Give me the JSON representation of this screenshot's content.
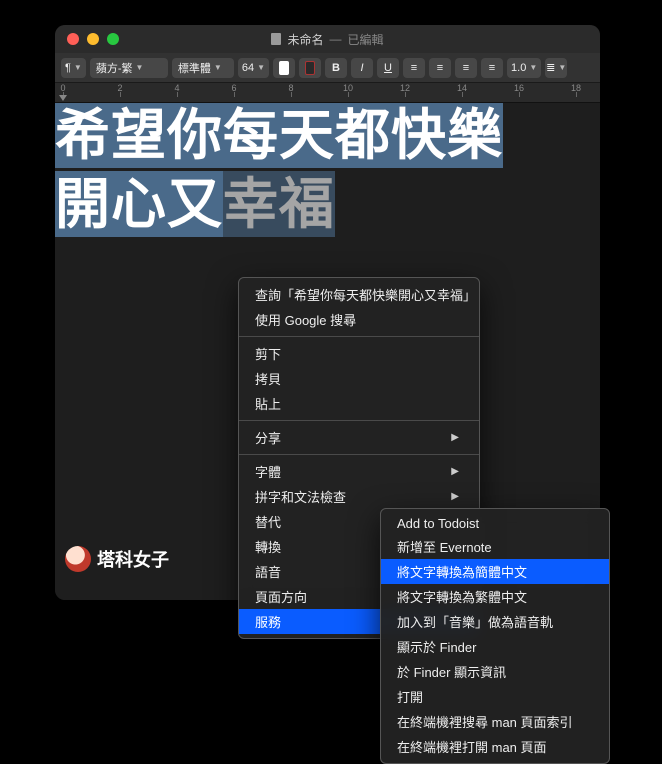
{
  "title": {
    "name": "未命名",
    "edited": "已編輯",
    "sep": "—"
  },
  "toolbar": {
    "paragraph": "¶",
    "font_family": "蘋方-繁",
    "font_style": "標準體",
    "font_size": "64",
    "bold": "B",
    "italic": "I",
    "underline": "U",
    "spacing": "1.0"
  },
  "ruler_ticks": [
    "0",
    "2",
    "4",
    "6",
    "8",
    "10",
    "12",
    "14",
    "16",
    "18"
  ],
  "document": {
    "line1": "希望你每天都快樂",
    "line2a": "開心又",
    "line2b": "幸福"
  },
  "logo": "塔科女子",
  "menu1": {
    "lookup": "查詢「希望你每天都快樂開心又幸福」",
    "google": "使用 Google 搜尋",
    "cut": "剪下",
    "copy": "拷貝",
    "paste": "貼上",
    "share": "分享",
    "font": "字體",
    "spellgrammar": "拼字和文法檢查",
    "substitute": "替代",
    "transform": "轉換",
    "speech": "語音",
    "pagedir": "頁面方向",
    "services": "服務"
  },
  "menu2": {
    "todoist": "Add to Todoist",
    "evernote": "新增至 Evernote",
    "to_simplified": "將文字轉換為簡體中文",
    "to_traditional": "將文字轉換為繁體中文",
    "add_music": "加入到「音樂」做為語音軌",
    "show_finder": "顯示於 Finder",
    "finder_info": "於 Finder 顯示資訊",
    "open": "打開",
    "man_search": "在終端機裡搜尋 man 頁面索引",
    "man_open": "在終端機裡打開 man 頁面"
  }
}
